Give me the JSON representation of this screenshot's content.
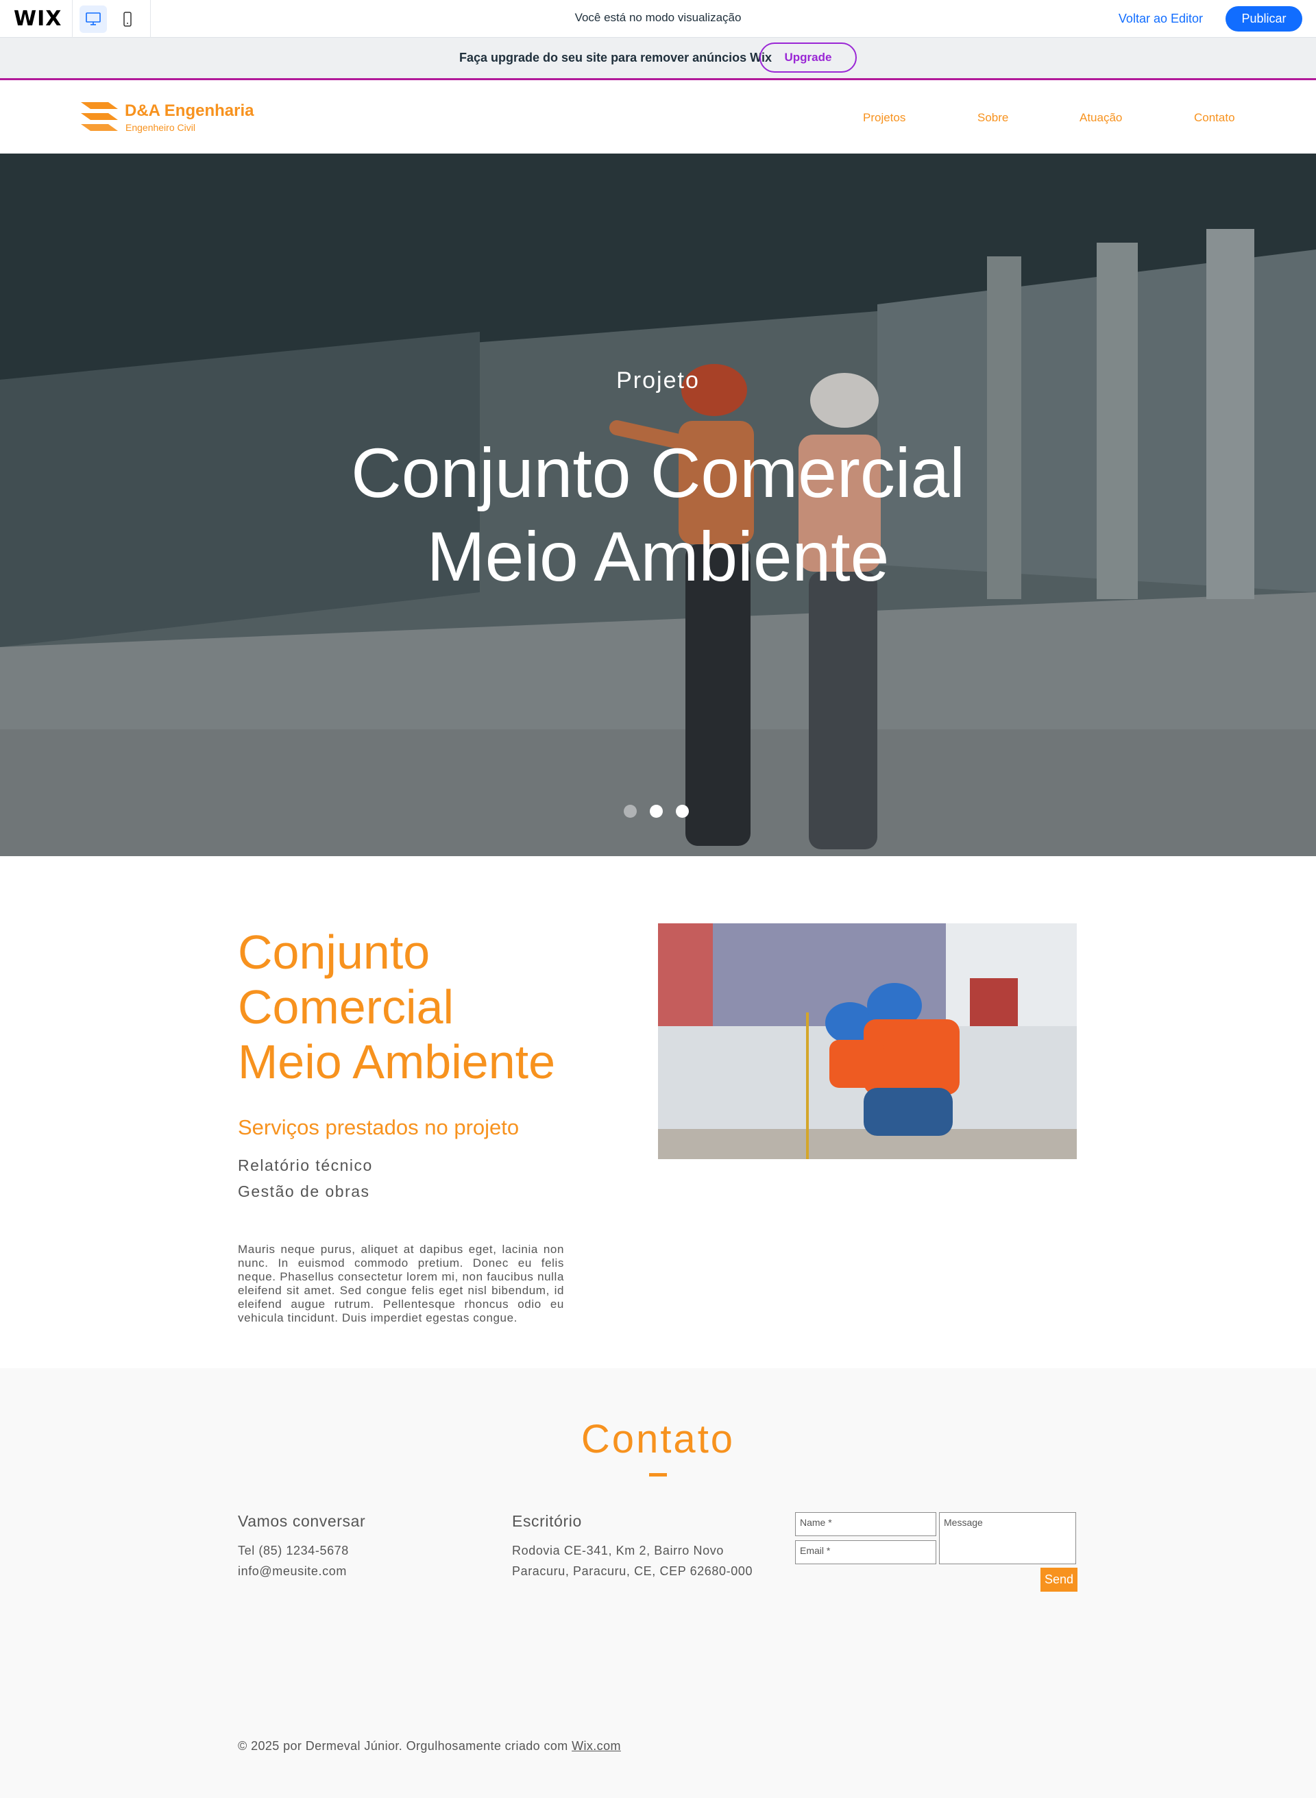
{
  "wix_bar": {
    "logo": "WIX",
    "preview_text": "Você está no modo visualização",
    "back_to_editor": "Voltar ao Editor",
    "publish": "Publicar",
    "accent": "#116dff"
  },
  "upgrade_banner": {
    "text": "Faça upgrade do seu site para remover anúncios Wix",
    "button": "Upgrade",
    "accent": "#9a27d5"
  },
  "header": {
    "brand_name": "D&A Engenharia",
    "brand_subtitle": "Engenheiro Civil",
    "nav": [
      "Projetos",
      "Sobre",
      "Atuação",
      "Contato"
    ],
    "brand_color": "#f7921e"
  },
  "hero": {
    "kicker": "Projeto",
    "title_line1": "Conjunto Comercial",
    "title_line2": "Meio Ambiente",
    "slides": 3,
    "active_slide": 2
  },
  "project": {
    "title_line1": "Conjunto",
    "title_line2": "Comercial",
    "title_line3": "Meio Ambiente",
    "services_heading": "Serviços prestados no projeto",
    "services": [
      "Relatório técnico",
      "Gestão de obras"
    ],
    "body": "Mauris neque purus, aliquet at dapibus eget, lacinia non nunc. In euismod commodo pretium. Donec eu felis neque. Phasellus consectetur lorem mi, non faucibus nulla eleifend sit amet. Sed congue felis eget nisl bibendum, id eleifend augue rutrum. Pellentesque rhoncus odio eu vehicula tincidunt. Duis imperdiet egestas congue."
  },
  "contact": {
    "title": "Contato",
    "talk_heading": "Vamos conversar",
    "phone": "Tel (85) 1234-5678",
    "email": "info@meusite.com",
    "office_heading": "Escritório",
    "address_line1": "Rodovia CE-341, Km 2, Bairro Novo",
    "address_line2": "Paracuru, Paracuru, CE, CEP 62680-000",
    "form": {
      "name_placeholder": "Name *",
      "email_placeholder": "Email *",
      "message_placeholder": "Message",
      "send": "Send"
    }
  },
  "footer": {
    "text": "© 2025 por Dermeval Júnior. Orgulhosamente criado com ",
    "link": "Wix.com"
  }
}
